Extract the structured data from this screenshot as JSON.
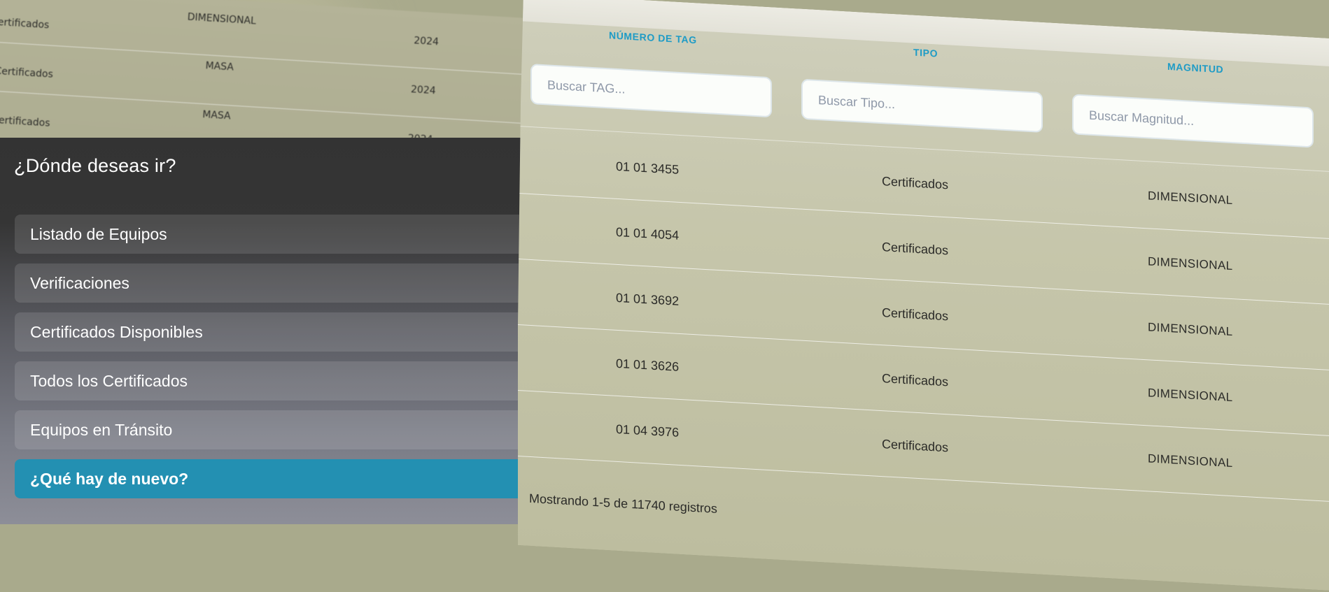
{
  "background_table": {
    "rows": [
      {
        "tipo": "ertificados",
        "magnitud": "DIMENSIONAL",
        "anio": "2024"
      },
      {
        "tipo": "Certificados",
        "magnitud": "MASA",
        "anio": "2024"
      },
      {
        "tipo": "Certificados",
        "magnitud": "MASA",
        "anio": "2024"
      }
    ]
  },
  "nav": {
    "title": "¿Dónde deseas ir?",
    "items": [
      {
        "label": "Listado de Equipos"
      },
      {
        "label": "Verificaciones"
      },
      {
        "label": "Certificados Disponibles"
      },
      {
        "label": "Todos los Certificados"
      },
      {
        "label": "Equipos en Tránsito"
      },
      {
        "label": "¿Qué hay de nuevo?",
        "active": true
      }
    ]
  },
  "table": {
    "headers": {
      "tag": "NÚMERO DE TAG",
      "tipo": "TIPO",
      "magnitud": "MAGNITUD"
    },
    "filters": {
      "tag_placeholder": "Buscar TAG...",
      "tipo_placeholder": "Buscar Tipo...",
      "magnitud_placeholder": "Buscar Magnitud..."
    },
    "rows": [
      {
        "tag": "01 01 3455",
        "tipo": "Certificados",
        "magnitud": "DIMENSIONAL"
      },
      {
        "tag": "01 01 4054",
        "tipo": "Certificados",
        "magnitud": "DIMENSIONAL"
      },
      {
        "tag": "01 01 3692",
        "tipo": "Certificados",
        "magnitud": "DIMENSIONAL"
      },
      {
        "tag": "01 01 3626",
        "tipo": "Certificados",
        "magnitud": "DIMENSIONAL"
      },
      {
        "tag": "01 04 3976",
        "tipo": "Certificados",
        "magnitud": "DIMENSIONAL"
      }
    ],
    "footer": "Mostrando 1-5 de 11740 registros"
  },
  "colors": {
    "accent": "#2390b2",
    "header_text": "#1e9bc6",
    "nav_bg": "#333333"
  }
}
